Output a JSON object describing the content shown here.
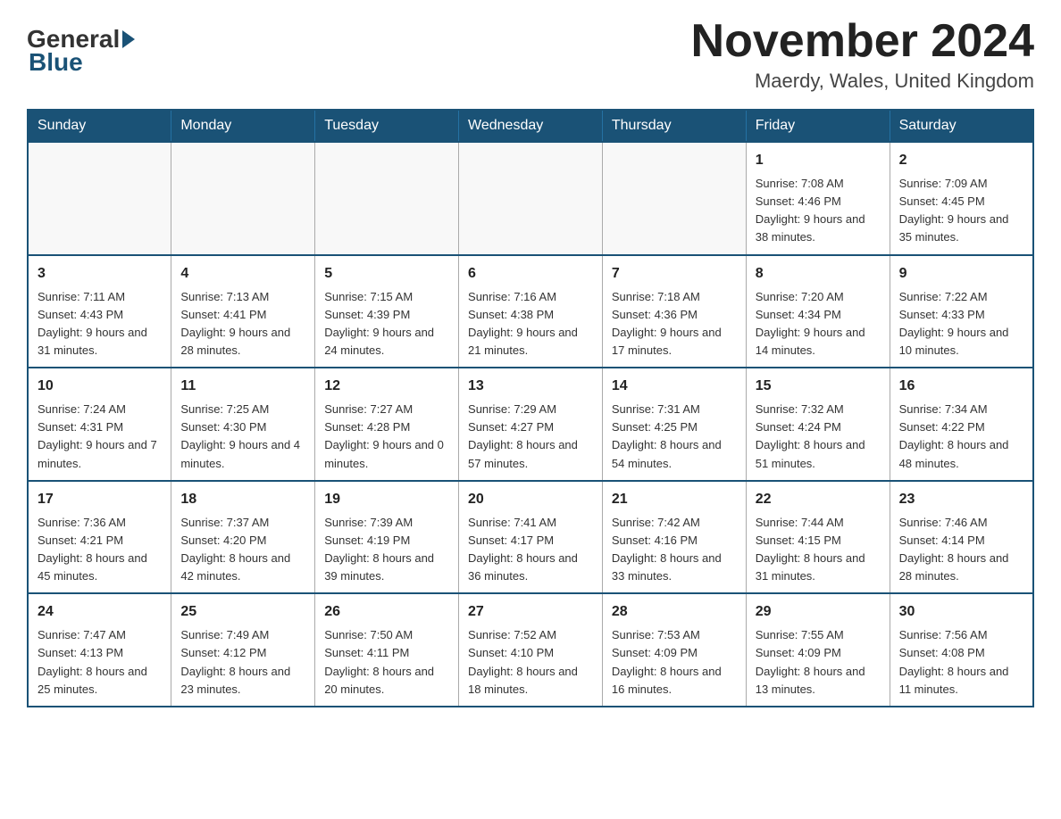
{
  "logo": {
    "text_general": "General",
    "text_blue": "Blue"
  },
  "title": "November 2024",
  "location": "Maerdy, Wales, United Kingdom",
  "weekdays": [
    "Sunday",
    "Monday",
    "Tuesday",
    "Wednesday",
    "Thursday",
    "Friday",
    "Saturday"
  ],
  "weeks": [
    [
      {
        "day": "",
        "info": ""
      },
      {
        "day": "",
        "info": ""
      },
      {
        "day": "",
        "info": ""
      },
      {
        "day": "",
        "info": ""
      },
      {
        "day": "",
        "info": ""
      },
      {
        "day": "1",
        "info": "Sunrise: 7:08 AM\nSunset: 4:46 PM\nDaylight: 9 hours and 38 minutes."
      },
      {
        "day": "2",
        "info": "Sunrise: 7:09 AM\nSunset: 4:45 PM\nDaylight: 9 hours and 35 minutes."
      }
    ],
    [
      {
        "day": "3",
        "info": "Sunrise: 7:11 AM\nSunset: 4:43 PM\nDaylight: 9 hours and 31 minutes."
      },
      {
        "day": "4",
        "info": "Sunrise: 7:13 AM\nSunset: 4:41 PM\nDaylight: 9 hours and 28 minutes."
      },
      {
        "day": "5",
        "info": "Sunrise: 7:15 AM\nSunset: 4:39 PM\nDaylight: 9 hours and 24 minutes."
      },
      {
        "day": "6",
        "info": "Sunrise: 7:16 AM\nSunset: 4:38 PM\nDaylight: 9 hours and 21 minutes."
      },
      {
        "day": "7",
        "info": "Sunrise: 7:18 AM\nSunset: 4:36 PM\nDaylight: 9 hours and 17 minutes."
      },
      {
        "day": "8",
        "info": "Sunrise: 7:20 AM\nSunset: 4:34 PM\nDaylight: 9 hours and 14 minutes."
      },
      {
        "day": "9",
        "info": "Sunrise: 7:22 AM\nSunset: 4:33 PM\nDaylight: 9 hours and 10 minutes."
      }
    ],
    [
      {
        "day": "10",
        "info": "Sunrise: 7:24 AM\nSunset: 4:31 PM\nDaylight: 9 hours and 7 minutes."
      },
      {
        "day": "11",
        "info": "Sunrise: 7:25 AM\nSunset: 4:30 PM\nDaylight: 9 hours and 4 minutes."
      },
      {
        "day": "12",
        "info": "Sunrise: 7:27 AM\nSunset: 4:28 PM\nDaylight: 9 hours and 0 minutes."
      },
      {
        "day": "13",
        "info": "Sunrise: 7:29 AM\nSunset: 4:27 PM\nDaylight: 8 hours and 57 minutes."
      },
      {
        "day": "14",
        "info": "Sunrise: 7:31 AM\nSunset: 4:25 PM\nDaylight: 8 hours and 54 minutes."
      },
      {
        "day": "15",
        "info": "Sunrise: 7:32 AM\nSunset: 4:24 PM\nDaylight: 8 hours and 51 minutes."
      },
      {
        "day": "16",
        "info": "Sunrise: 7:34 AM\nSunset: 4:22 PM\nDaylight: 8 hours and 48 minutes."
      }
    ],
    [
      {
        "day": "17",
        "info": "Sunrise: 7:36 AM\nSunset: 4:21 PM\nDaylight: 8 hours and 45 minutes."
      },
      {
        "day": "18",
        "info": "Sunrise: 7:37 AM\nSunset: 4:20 PM\nDaylight: 8 hours and 42 minutes."
      },
      {
        "day": "19",
        "info": "Sunrise: 7:39 AM\nSunset: 4:19 PM\nDaylight: 8 hours and 39 minutes."
      },
      {
        "day": "20",
        "info": "Sunrise: 7:41 AM\nSunset: 4:17 PM\nDaylight: 8 hours and 36 minutes."
      },
      {
        "day": "21",
        "info": "Sunrise: 7:42 AM\nSunset: 4:16 PM\nDaylight: 8 hours and 33 minutes."
      },
      {
        "day": "22",
        "info": "Sunrise: 7:44 AM\nSunset: 4:15 PM\nDaylight: 8 hours and 31 minutes."
      },
      {
        "day": "23",
        "info": "Sunrise: 7:46 AM\nSunset: 4:14 PM\nDaylight: 8 hours and 28 minutes."
      }
    ],
    [
      {
        "day": "24",
        "info": "Sunrise: 7:47 AM\nSunset: 4:13 PM\nDaylight: 8 hours and 25 minutes."
      },
      {
        "day": "25",
        "info": "Sunrise: 7:49 AM\nSunset: 4:12 PM\nDaylight: 8 hours and 23 minutes."
      },
      {
        "day": "26",
        "info": "Sunrise: 7:50 AM\nSunset: 4:11 PM\nDaylight: 8 hours and 20 minutes."
      },
      {
        "day": "27",
        "info": "Sunrise: 7:52 AM\nSunset: 4:10 PM\nDaylight: 8 hours and 18 minutes."
      },
      {
        "day": "28",
        "info": "Sunrise: 7:53 AM\nSunset: 4:09 PM\nDaylight: 8 hours and 16 minutes."
      },
      {
        "day": "29",
        "info": "Sunrise: 7:55 AM\nSunset: 4:09 PM\nDaylight: 8 hours and 13 minutes."
      },
      {
        "day": "30",
        "info": "Sunrise: 7:56 AM\nSunset: 4:08 PM\nDaylight: 8 hours and 11 minutes."
      }
    ]
  ]
}
